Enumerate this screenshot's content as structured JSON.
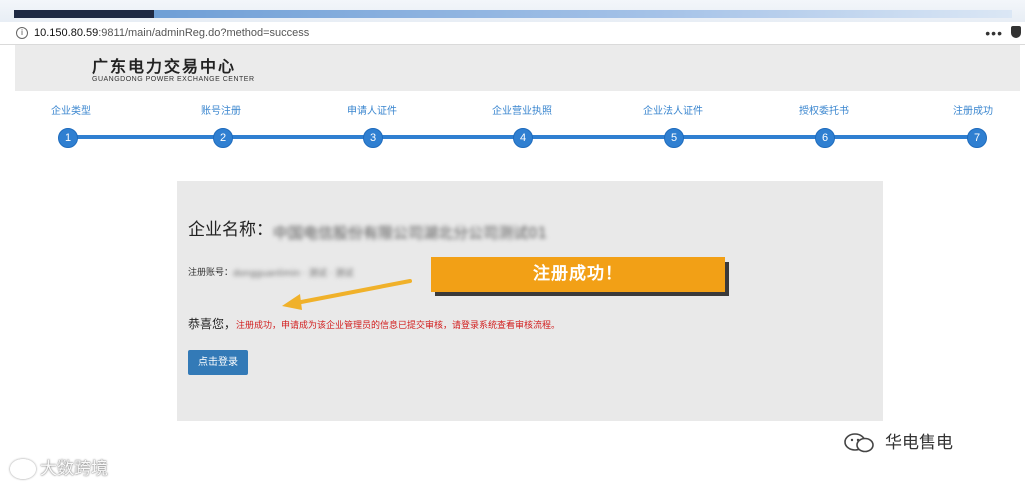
{
  "browser": {
    "url_host": "10.150.80.59",
    "url_rest": ":9811/main/adminReg.do?method=success",
    "more_label": "•••"
  },
  "header": {
    "logo_cn": "广东电力交易中心",
    "logo_en": "GUANGDONG POWER EXCHANGE CENTER"
  },
  "steps": [
    {
      "label": "企业类型",
      "number": "1"
    },
    {
      "label": "账号注册",
      "number": "2"
    },
    {
      "label": "申请人证件",
      "number": "3"
    },
    {
      "label": "企业营业执照",
      "number": "4"
    },
    {
      "label": "企业法人证件",
      "number": "5"
    },
    {
      "label": "授权委托书",
      "number": "6"
    },
    {
      "label": "注册成功",
      "number": "7"
    }
  ],
  "result": {
    "company_label": "企业名称：",
    "company_value": "中国电信股份有限公司湖北分公司测试01",
    "account_label": "注册账号：",
    "account_value": "dongguanlimin · 测试 · 测试",
    "congrats_label": "恭喜您，",
    "congrats_message": "注册成功，申请成为该企业管理员的信息已提交审核，请登录系统查看审核流程。",
    "login_button": "点击登录"
  },
  "callout": {
    "text": "注册成功！"
  },
  "watermarks": {
    "left": "大数跨境",
    "right": "华电售电"
  },
  "colors": {
    "step_blue": "#2f7fd1",
    "button_blue": "#337ab7",
    "message_red": "#d21d1d",
    "callout_orange": "#f2a016"
  }
}
